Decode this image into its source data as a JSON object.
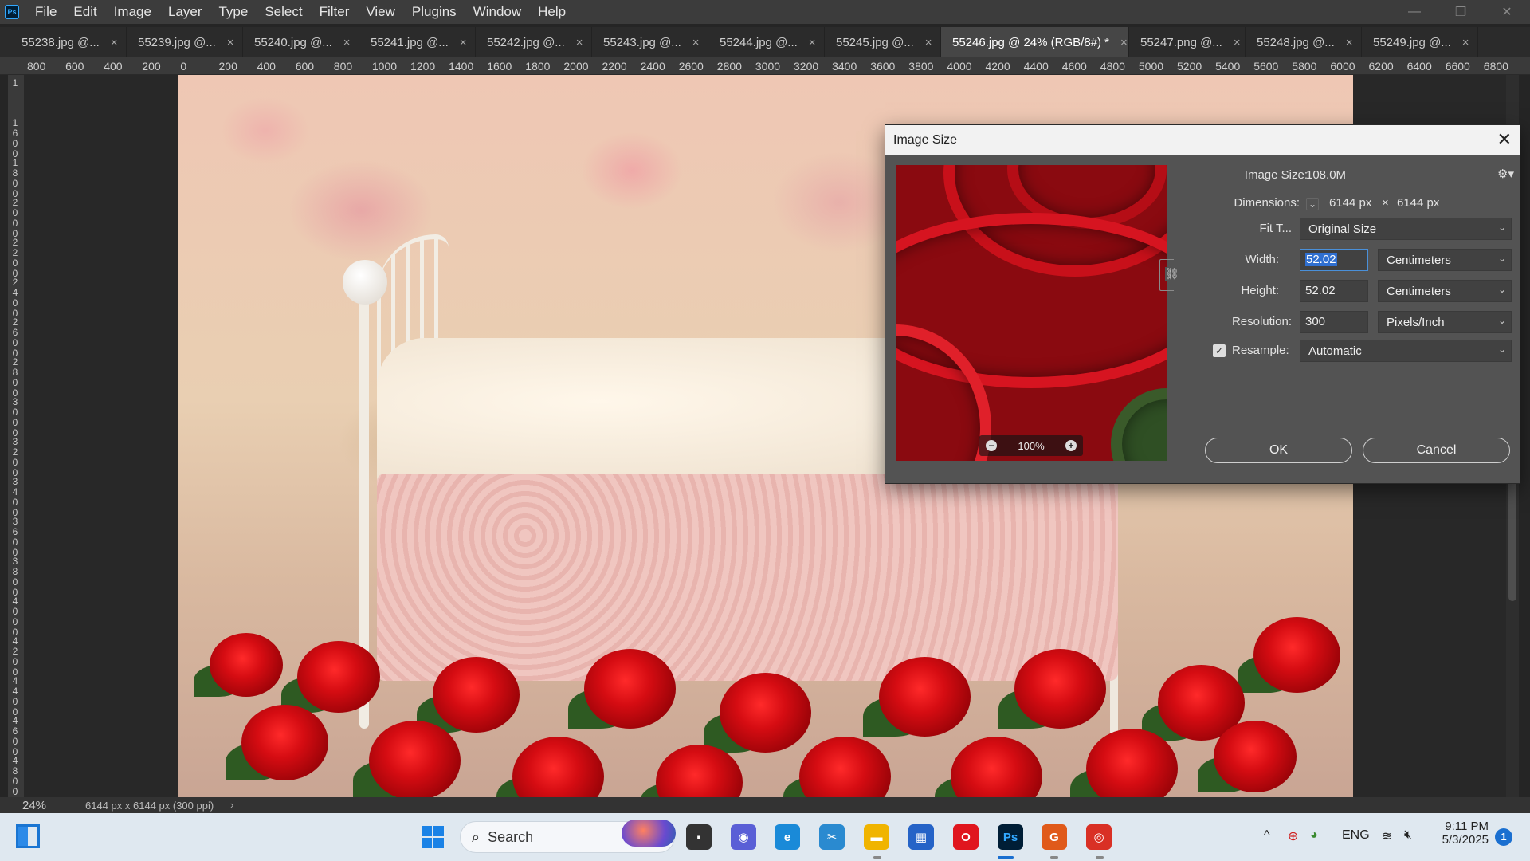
{
  "menu": [
    "File",
    "Edit",
    "Image",
    "Layer",
    "Type",
    "Select",
    "Filter",
    "View",
    "Plugins",
    "Window",
    "Help"
  ],
  "app_logo": "Ps",
  "window_controls": {
    "minimize": "—",
    "restore": "❐",
    "close": "✕"
  },
  "tabs": [
    {
      "label": "55238.jpg @...",
      "active": false
    },
    {
      "label": "55239.jpg @...",
      "active": false
    },
    {
      "label": "55240.jpg @...",
      "active": false
    },
    {
      "label": "55241.jpg @...",
      "active": false
    },
    {
      "label": "55242.jpg @...",
      "active": false
    },
    {
      "label": "55243.jpg @...",
      "active": false
    },
    {
      "label": "55244.jpg @...",
      "active": false
    },
    {
      "label": "55245.jpg @...",
      "active": false
    },
    {
      "label": "55246.jpg @ 24% (RGB/8#) *",
      "active": true
    },
    {
      "label": "55247.png @...",
      "active": false
    },
    {
      "label": "55248.jpg @...",
      "active": false
    },
    {
      "label": "55249.jpg @...",
      "active": false
    }
  ],
  "tab_close_glyph": "×",
  "ruler_top_labels": [
    "800",
    "600",
    "400",
    "200",
    "0",
    "200",
    "400",
    "600",
    "800",
    "1000",
    "1200",
    "1400",
    "1600",
    "1800",
    "2000",
    "2200",
    "2400",
    "2600",
    "2800",
    "3000",
    "3200",
    "3400",
    "3600",
    "3800",
    "4000",
    "4200",
    "4400",
    "4600",
    "4800",
    "5000",
    "5200",
    "5400",
    "5600",
    "5800",
    "6000",
    "6200",
    "6400",
    "6600",
    "6800"
  ],
  "ruler_left_labels": [
    "1",
    "1600",
    "1800",
    "2000",
    "2200",
    "2400",
    "2600",
    "2800",
    "3000",
    "3200",
    "3400",
    "3600",
    "3800",
    "4000",
    "4200",
    "4400",
    "4600",
    "4800"
  ],
  "status": {
    "zoom": "24%",
    "doc_info": "6144 px x 6144 px (300 ppi)",
    "arrow": "›"
  },
  "dialog": {
    "title": "Image Size",
    "close": "✕",
    "image_size_label": "Image Size:",
    "image_size_value": "108.0M",
    "dimensions_label": "Dimensions:",
    "dimensions_width": "6144 px",
    "dimensions_x": "×",
    "dimensions_height": "6144 px",
    "fit_to_label": "Fit T...",
    "fit_to_value": "Original Size",
    "width_label": "Width:",
    "width_value": "52.02",
    "width_unit": "Centimeters",
    "height_label": "Height:",
    "height_value": "52.02",
    "height_unit": "Centimeters",
    "resolution_label": "Resolution:",
    "resolution_value": "300",
    "resolution_unit": "Pixels/Inch",
    "resample_label": "Resample:",
    "resample_checked": true,
    "resample_value": "Automatic",
    "preview_zoom": "100%",
    "ok_label": "OK",
    "cancel_label": "Cancel"
  },
  "taskbar": {
    "search_placeholder": "Search",
    "apps": [
      {
        "name": "task-view",
        "glyph": "▪",
        "color": "#333333"
      },
      {
        "name": "meet",
        "glyph": "◉",
        "color": "#5a5fd6"
      },
      {
        "name": "edge",
        "glyph": "e",
        "color": "#1a8ad8"
      },
      {
        "name": "snipping",
        "glyph": "✂",
        "color": "#2a8ad0"
      },
      {
        "name": "file-explorer",
        "glyph": "▬",
        "color": "#f0b400"
      },
      {
        "name": "store",
        "glyph": "▦",
        "color": "#2563c7"
      },
      {
        "name": "opera",
        "glyph": "O",
        "color": "#e0161e"
      },
      {
        "name": "photoshop",
        "glyph": "Ps",
        "color": "#001e36"
      },
      {
        "name": "brave",
        "glyph": "G",
        "color": "#e05a1a"
      },
      {
        "name": "chrome",
        "glyph": "◎",
        "color": "#d93025"
      }
    ],
    "tray": {
      "chevron": "^",
      "lang": "ENG",
      "wifi": "≋",
      "volume": "🔇︎"
    },
    "time": "9:11 PM",
    "date": "5/3/2025",
    "notifications": "1"
  }
}
